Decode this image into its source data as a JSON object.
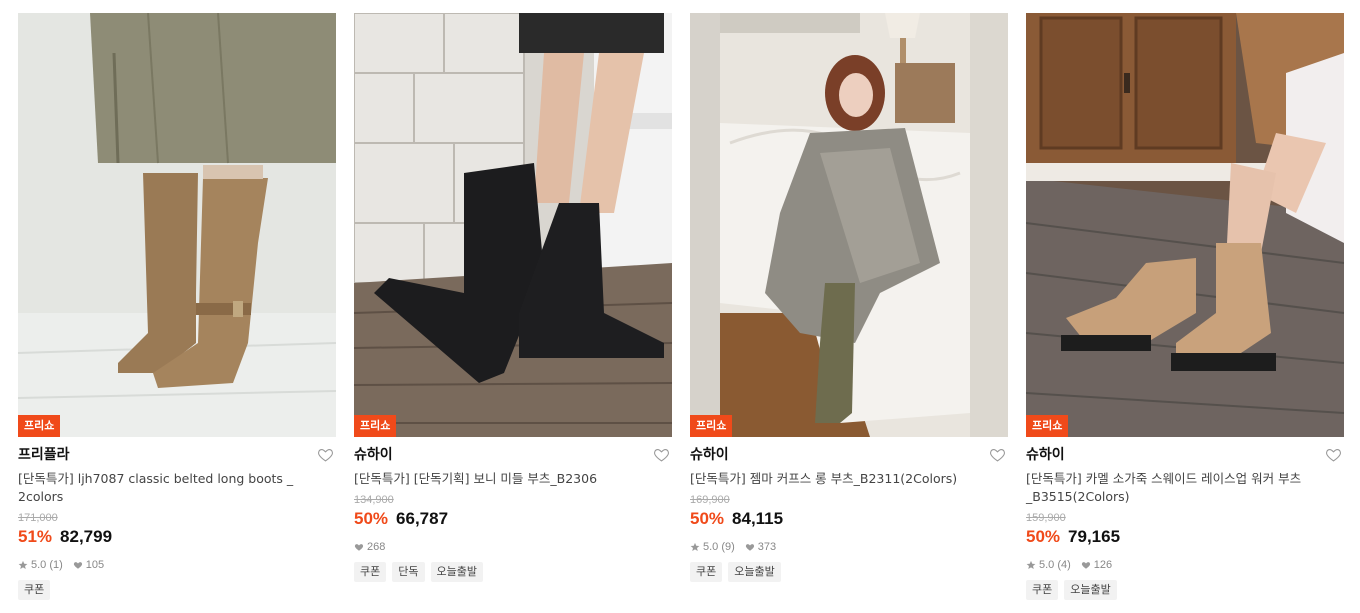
{
  "products": [
    {
      "badge": "프리쇼",
      "brand": "프리플라",
      "title": "[단독특가] ljh7087 classic belted long boots _ 2colors",
      "original_price": "171,000",
      "discount": "51%",
      "price": "82,799",
      "rating": "5.0 (1)",
      "likes": "105",
      "tags": [
        "쿠폰"
      ],
      "image_desc": "tan-suede-belted-long-boots"
    },
    {
      "badge": "프리쇼",
      "brand": "슈하이",
      "title": "[단독특가] [단독기획] 보니 미들 부츠_B2306",
      "original_price": "134,900",
      "discount": "50%",
      "price": "66,787",
      "rating": "",
      "likes": "268",
      "tags": [
        "쿠폰",
        "단독",
        "오늘출발"
      ],
      "image_desc": "black-leather-middle-boots"
    },
    {
      "badge": "프리쇼",
      "brand": "슈하이",
      "title": "[단독특가] 젬마 커프스 롱 부츠_B2311(2Colors)",
      "original_price": "169,900",
      "discount": "50%",
      "price": "84,115",
      "rating": "5.0 (9)",
      "likes": "373",
      "tags": [
        "쿠폰",
        "오늘출발"
      ],
      "image_desc": "khaki-cuffed-long-boots"
    },
    {
      "badge": "프리쇼",
      "brand": "슈하이",
      "title": "[단독특가] 카멜 소가죽 스웨이드 레이스업 워커 부츠_B3515(2Colors)",
      "original_price": "159,900",
      "discount": "50%",
      "price": "79,165",
      "rating": "5.0 (4)",
      "likes": "126",
      "tags": [
        "쿠폰",
        "오늘출발"
      ],
      "image_desc": "camel-suede-lace-up-walker-boots"
    }
  ],
  "colors": {
    "accent": "#f04a1a",
    "strike": "#aaaaaa",
    "tag_bg": "#f2f2f2"
  }
}
